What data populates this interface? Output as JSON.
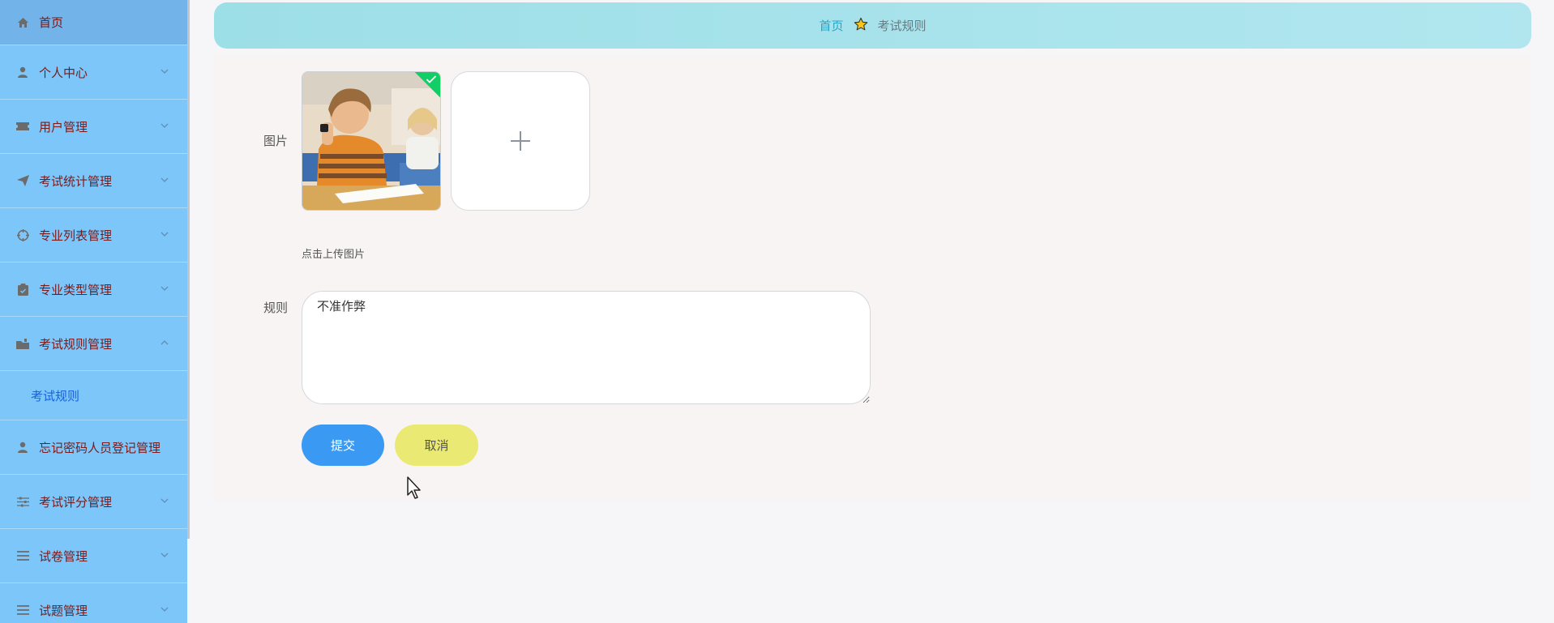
{
  "sidebar": {
    "items": [
      {
        "label": "首页",
        "icon": "home-icon"
      },
      {
        "label": "个人中心",
        "icon": "user-icon"
      },
      {
        "label": "用户管理",
        "icon": "ticket-icon"
      },
      {
        "label": "考试统计管理",
        "icon": "paper-plane-icon"
      },
      {
        "label": "专业列表管理",
        "icon": "crosshair-icon"
      },
      {
        "label": "专业类型管理",
        "icon": "clipboard-icon"
      },
      {
        "label": "考试规则管理",
        "icon": "folder-icon"
      },
      {
        "label": "忘记密码人员登记管理",
        "icon": "user-icon"
      },
      {
        "label": "考试评分管理",
        "icon": "sliders-icon"
      },
      {
        "label": "试卷管理",
        "icon": "menu-icon"
      },
      {
        "label": "试题管理",
        "icon": "menu-icon"
      }
    ],
    "subitem_label": "考试规则"
  },
  "breadcrumb": {
    "home": "首页",
    "current": "考试规则"
  },
  "form": {
    "image_label": "图片",
    "upload_hint": "点击上传图片",
    "rule_label": "规则",
    "rule_value": "不准作弊"
  },
  "buttons": {
    "submit": "提交",
    "cancel": "取消"
  },
  "colors": {
    "sidebar_bg": "#7cc6f9",
    "header_bg": "#9ddfe7",
    "submit_bg": "#3a99f3",
    "cancel_bg": "#e9e973",
    "success_badge": "#13ce66"
  }
}
